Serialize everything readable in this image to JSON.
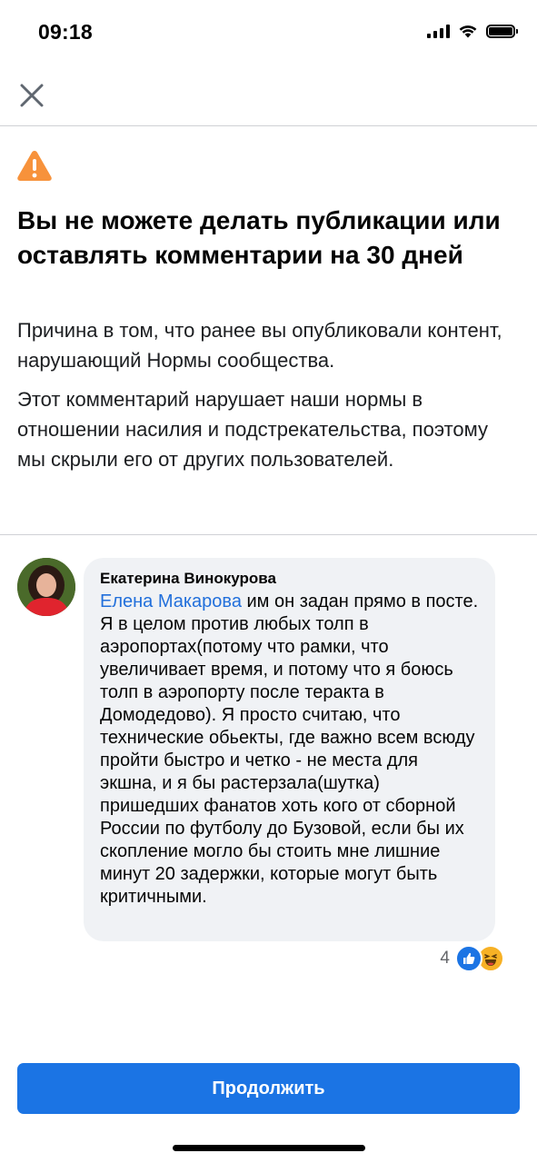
{
  "status_bar": {
    "time": "09:18",
    "icons": [
      "cellular-signal-icon",
      "wifi-icon",
      "battery-icon"
    ]
  },
  "header": {
    "close_icon": "close-icon"
  },
  "notice": {
    "icon": "warning-icon",
    "title": "Вы не можете делать публикации или оставлять комментарии на 30 дней",
    "reason": "Причина в том, что ранее вы опубликовали контент, нарушающий Нормы сообщества.",
    "explanation": "Этот комментарий нарушает наши нормы в отношении насилия и подстрекательства, поэтому мы скрыли его от других пользователей."
  },
  "comment": {
    "author": "Екатерина Винокурова",
    "mention": "Елена Макарова",
    "text": " им он задан прямо в посте. Я в целом против любых толп в аэропортах(потому что рамки, что увеличивает время, и потому что я боюсь толп в аэропорту после теракта в Домодедово). Я просто считаю, что технические обьекты, где важно всем всюду пройти быстро и четко - не места для экшна, и я бы растерзала(шутка) пришедших фанатов хоть кого от сборной России по футболу до Бузовой, если бы их скопление могло бы стоить мне лишние минут 20 задержки, которые могут быть критичными.",
    "reaction_count": "4",
    "reactions": [
      "like-reaction-icon",
      "haha-reaction-icon"
    ]
  },
  "footer": {
    "continue_label": "Продолжить"
  },
  "colors": {
    "accent": "#1b74e4",
    "mention": "#216fdb",
    "warning": "#f7923b",
    "bubble": "#f0f2f5",
    "divider": "#cfd1d5"
  }
}
